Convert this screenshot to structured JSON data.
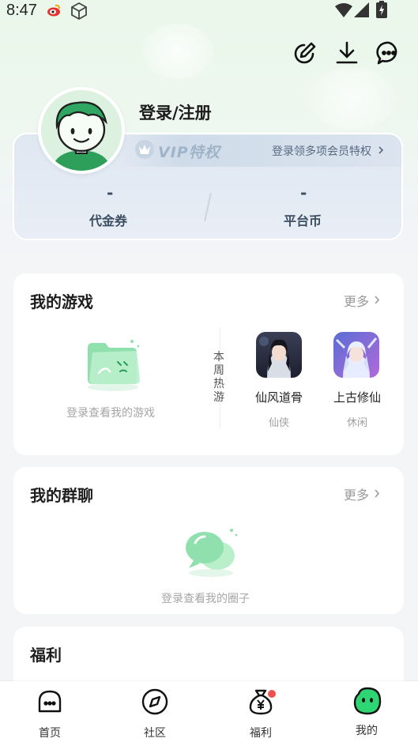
{
  "status_bar": {
    "time": "8:47",
    "icons": [
      "weibo-notification-icon",
      "cube-icon",
      "wifi-icon",
      "signal-icon",
      "battery-charging-icon"
    ]
  },
  "header": {
    "icons": [
      "edit-icon",
      "download-icon",
      "message-icon"
    ]
  },
  "profile": {
    "login_label": "登录/注册",
    "vip_badge": "VIP特权",
    "vip_link": "登录领多项会员特权",
    "stats": [
      {
        "value": "-",
        "label": "代金券"
      },
      {
        "value": "-",
        "label": "平台币"
      }
    ]
  },
  "my_games": {
    "title": "我的游戏",
    "more": "更多",
    "empty_text": "登录查看我的游戏",
    "hot_label": "本周热游",
    "games": [
      {
        "name": "仙风道骨",
        "tag": "仙侠"
      },
      {
        "name": "上古修仙",
        "tag": "休闲"
      }
    ]
  },
  "my_groups": {
    "title": "我的群聊",
    "more": "更多",
    "empty_text": "登录查看我的圈子"
  },
  "welfare": {
    "title": "福利"
  },
  "bottom_nav": {
    "items": [
      {
        "label": "首页",
        "icon": "home-icon"
      },
      {
        "label": "社区",
        "icon": "compass-icon"
      },
      {
        "label": "福利",
        "icon": "money-bag-icon"
      },
      {
        "label": "我的",
        "icon": "profile-face-icon"
      }
    ]
  },
  "colors": {
    "brand_green": "#2ed573",
    "badge_red": "#f0514f",
    "vip_text": "#9fb3c9"
  }
}
